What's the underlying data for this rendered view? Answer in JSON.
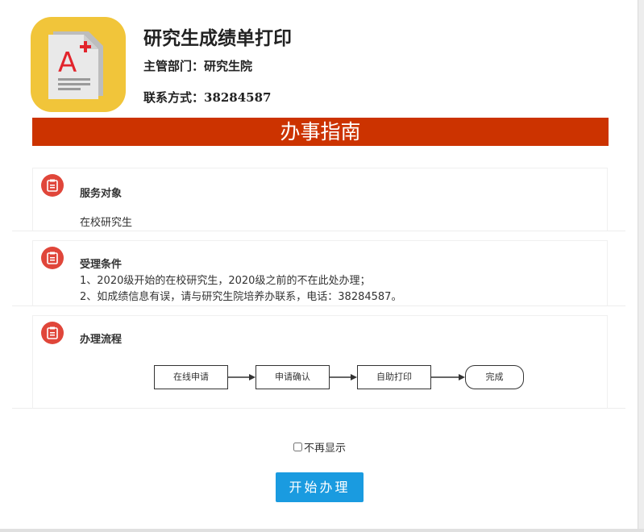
{
  "header": {
    "title": "研究生成绩单打印",
    "department": "主管部门：研究生院",
    "contact": "联系方式：38284587",
    "icon_badge": "A"
  },
  "guide": {
    "title": "办事指南"
  },
  "sections": [
    {
      "title": "服务对象",
      "lines": [
        "在校研究生"
      ]
    },
    {
      "title": "受理条件",
      "lines": [
        "1、2020级开始的在校研究生，2020级之前的不在此处办理；",
        "2、如成绩信息有误，请与研究生院培养办联系，电话：38284587。"
      ]
    },
    {
      "title": "办理流程"
    }
  ],
  "flow": {
    "steps": [
      "在线申请",
      "申请确认",
      "自助打印",
      "完成"
    ]
  },
  "footer": {
    "dont_show_label": "不再显示",
    "dont_show_checked": false,
    "start_button": "开始办理"
  },
  "colors": {
    "guide_bar": "#cc3300",
    "button": "#1a9be0",
    "section_icon": "#e0463a",
    "app_icon_bg": "#f1c53a"
  }
}
